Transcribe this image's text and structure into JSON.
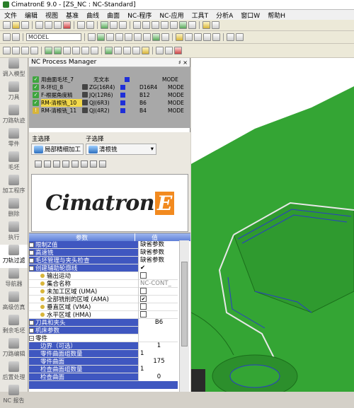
{
  "window": {
    "title": "CimatronE 9.0 - [ZS_NC : NC-Standard]"
  },
  "menu": [
    "文件",
    "编辑",
    "视图",
    "基准",
    "曲线",
    "曲面",
    "NC-程序",
    "NC-应用",
    "工具T",
    "分析A",
    "窗口W",
    "帮助H"
  ],
  "toolbar": {
    "combo_model": "MODEL"
  },
  "left_tabs": [
    "调入模型",
    "刀具",
    "刀路轨迹",
    "零件",
    "毛坯",
    "加工程序",
    "删除",
    "执行",
    "刀轨过滤",
    "导航器",
    "高级仿真",
    "剩余毛坯",
    "刀路编辑",
    "后置处理",
    "NC 报告"
  ],
  "panel": {
    "title": "NC Process Manager",
    "pins": "♯ × "
  },
  "procs": [
    {
      "name": "用曲面毛坯_7",
      "extra": "无文本",
      "tool": "",
      "val": "",
      "status": "MODE"
    },
    {
      "name": "R-环切_8",
      "extra": "",
      "tool": "ZG(16R4)",
      "val": "D16R4",
      "status": "MODE"
    },
    {
      "name": "F-根据角度精",
      "extra": "",
      "tool": "JQ(12R6)",
      "val": "B12",
      "status": "MODE"
    },
    {
      "name": "RM-清根铣_10",
      "extra": "",
      "tool": "QJ(6R3)",
      "val": "B6",
      "status": "MODE"
    },
    {
      "name": "RM-清根铣_11",
      "extra": "",
      "tool": "QJ(4R2)",
      "val": "B4",
      "status": "MODE"
    }
  ],
  "select": {
    "main_label": "主选择",
    "sub_label": "子选择",
    "main_value": "局部精细加工",
    "sub_value": "清根铣"
  },
  "logo": {
    "text": "Cimatron",
    "e": "E"
  },
  "params": {
    "col_param": "参数",
    "col_value": "值",
    "rows": [
      {
        "name": "限制Z值",
        "value": "缺省参数"
      },
      {
        "name": "高速铣",
        "value": "缺省参数"
      },
      {
        "name": "毛坯管理与夹头检查",
        "value": "缺省参数"
      },
      {
        "name": "创建辅助轮廓线",
        "value": "✔"
      },
      {
        "name": "输出运动",
        "value": ""
      },
      {
        "name": "集合名称",
        "value": "NC-CONT_"
      },
      {
        "name": "未加工区域 (UMA)",
        "value": ""
      },
      {
        "name": "全部铣削的区域 (AMA)",
        "value": "✔"
      },
      {
        "name": "垂直区域 (VMA)",
        "value": ""
      },
      {
        "name": "水平区域 (HMA)",
        "value": ""
      },
      {
        "name": "刀具和夹头",
        "value": "B6"
      },
      {
        "name": "机床参数",
        "value": ""
      },
      {
        "name": "零件",
        "value": ""
      },
      {
        "name": "边界（可选）",
        "value": "1"
      },
      {
        "name": "零件曲面组数量",
        "value": "1"
      },
      {
        "name": "零件曲面",
        "value": "175"
      },
      {
        "name": "检查曲面组数量",
        "value": "1"
      },
      {
        "name": "检查曲面",
        "value": "0"
      }
    ]
  },
  "colors": {
    "accent": "#3f57c0",
    "model": "#31a131"
  }
}
